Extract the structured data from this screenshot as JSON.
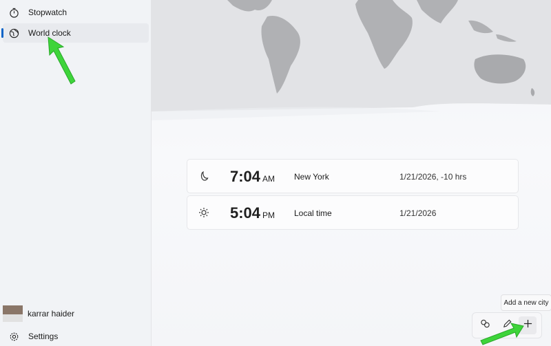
{
  "sidebar": {
    "items": [
      {
        "label": "Stopwatch",
        "icon": "stopwatch-icon"
      },
      {
        "label": "World clock",
        "icon": "globe-icon",
        "active": true
      }
    ],
    "user": {
      "name": "karrar haider"
    },
    "settings_label": "Settings"
  },
  "clocks": [
    {
      "icon": "moon-icon",
      "time": "7:04",
      "ampm": "AM",
      "city": "New York",
      "date": "1/21/2026, -10 hrs"
    },
    {
      "icon": "sun-icon",
      "time": "5:04",
      "ampm": "PM",
      "city": "Local time",
      "date": "1/21/2026"
    }
  ],
  "toolbar": {
    "tooltip": "Add a new city",
    "buttons": [
      "compare-icon",
      "edit-icon",
      "add-icon"
    ]
  },
  "colors": {
    "accent": "#0a64c8",
    "annotation_arrow": "#3ed43a"
  }
}
